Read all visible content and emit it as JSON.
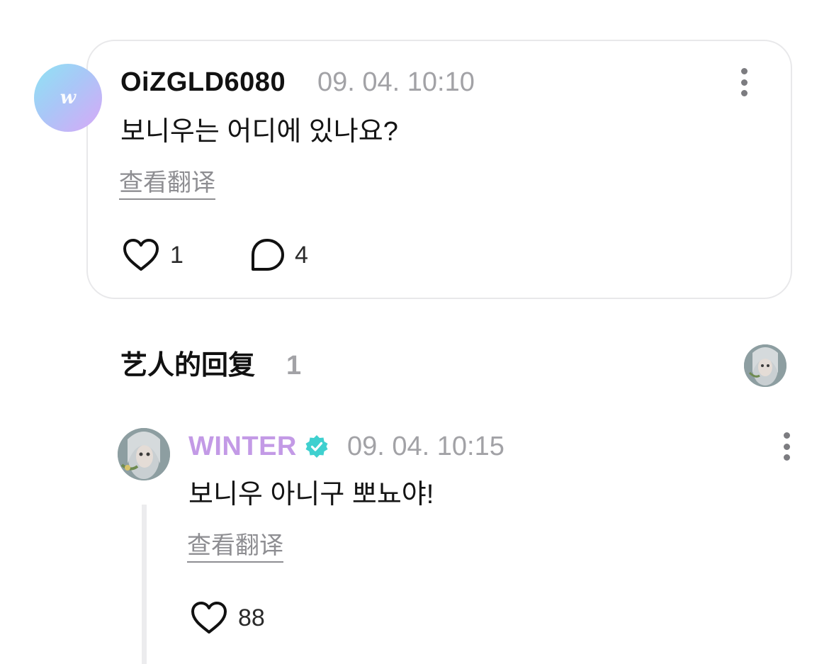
{
  "comment": {
    "username": "OiZGLD6080",
    "timestamp": "09. 04. 10:10",
    "text": "보니우는 어디에 있나요?",
    "translate_label": "查看翻译",
    "likes": "1",
    "replies": "4"
  },
  "artist_replies": {
    "title": "艺人的回复",
    "count": "1"
  },
  "artist_reply": {
    "name": "WINTER",
    "timestamp": "09. 04. 10:15",
    "text": "보니우 아니구 뽀뇨야!",
    "translate_label": "查看翻译",
    "likes": "88"
  },
  "icons": {
    "avatar": "weverse-logo-icon",
    "more": "more-vertical-icon",
    "like": "heart-icon",
    "reply": "speech-bubble-icon",
    "verified": "verified-badge-icon"
  },
  "colors": {
    "artist_name": "#c39ae6",
    "verified_badge": "#3fd0cf",
    "muted_text": "#a2a2a6"
  }
}
